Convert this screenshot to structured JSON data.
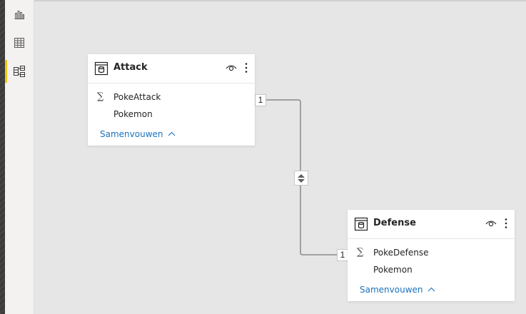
{
  "rail": {
    "items": [
      {
        "name": "report-view",
        "icon": "bar-chart-icon",
        "active": false
      },
      {
        "name": "data-view",
        "icon": "table-grid-icon",
        "active": false
      },
      {
        "name": "model-view",
        "icon": "model-diagram-icon",
        "active": true
      }
    ],
    "accent": "#f2c811"
  },
  "tables": [
    {
      "title": "Attack",
      "fields": [
        {
          "label": "PokeAttack",
          "aggregated": true
        },
        {
          "label": "Pokemon",
          "aggregated": false
        }
      ],
      "collapse_label": "Samenvouwen"
    },
    {
      "title": "Defense",
      "fields": [
        {
          "label": "PokeDefense",
          "aggregated": true
        },
        {
          "label": "Pokemon",
          "aggregated": false
        }
      ],
      "collapse_label": "Samenvouwen"
    }
  ],
  "relationship": {
    "from_cardinality": "1",
    "to_cardinality": "1",
    "cross_filter": "both"
  },
  "symbols": {
    "sigma": "∑"
  },
  "colors": {
    "link": "#1b72bd",
    "line": "#8a8886",
    "canvas": "#e6e6e6"
  }
}
